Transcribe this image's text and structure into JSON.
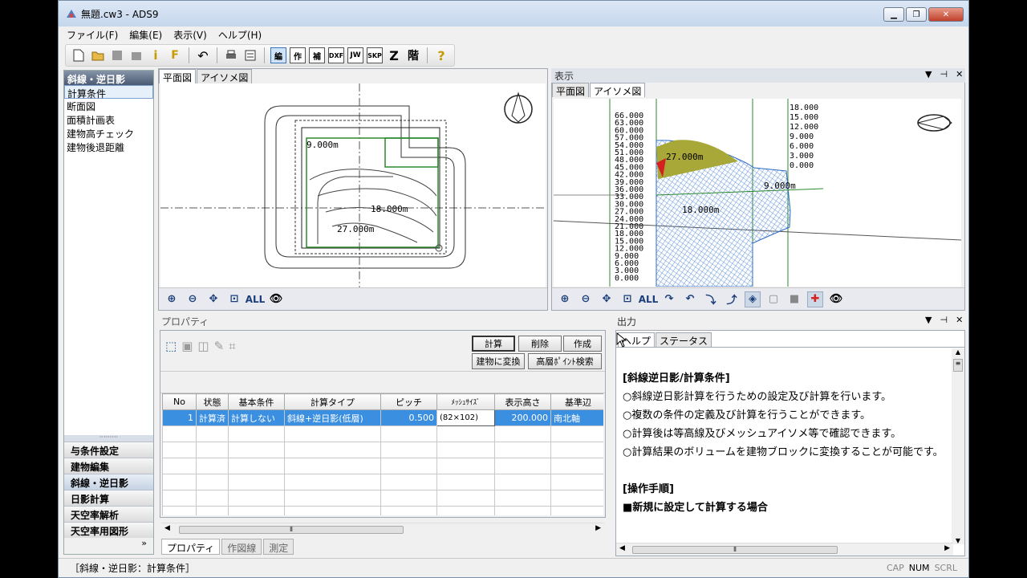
{
  "window": {
    "title": "無題.cw3 - ADS9",
    "min": "▁",
    "max": "❐",
    "close": "✕"
  },
  "menu": [
    "ファイル(F)",
    "編集(E)",
    "表示(V)",
    "ヘルプ(H)"
  ],
  "toolbar": {
    "edit": "編",
    "create": "作",
    "supp": "補",
    "dxf": "DXF",
    "jw": "JW",
    "skp": "SKP",
    "z": "Z",
    "floor": "階",
    "help": "?"
  },
  "sidebar": {
    "header": "斜線・逆日影",
    "items": [
      "計算条件",
      "断面図",
      "面積計画表",
      "建物高チェック",
      "建物後退距離"
    ],
    "nav": [
      "与条件設定",
      "建物編集",
      "斜線・逆日影",
      "日影計算",
      "天空率解析",
      "天空率用図形"
    ],
    "more": "»"
  },
  "plan_panel": {
    "tabs": [
      "平面図",
      "アイソメ図"
    ],
    "labels": [
      "9.000m",
      "18.000m",
      "27.000m"
    ],
    "all": "ALL"
  },
  "view_panel": {
    "title": "表示",
    "tabs": [
      "平面図",
      "アイソメ図"
    ],
    "left_scale": [
      "66.000",
      "63.000",
      "60.000",
      "57.000",
      "54.000",
      "51.000",
      "48.000",
      "45.000",
      "42.000",
      "39.000",
      "36.000",
      "33.000",
      "30.000",
      "27.000",
      "24.000",
      "21.000",
      "18.000",
      "15.000",
      "12.000",
      "9.000",
      "6.000",
      "3.000",
      "0.000"
    ],
    "right_scale": [
      "18.000",
      "15.000",
      "12.000",
      "9.000",
      "6.000",
      "3.000",
      "0.000"
    ],
    "labels": [
      "9.000m",
      "18.000m",
      "27.000m"
    ],
    "all": "ALL"
  },
  "props": {
    "title": "プロパティ",
    "buttons": {
      "calc": "計算",
      "delete": "削除",
      "create": "作成",
      "convert": "建物に変換",
      "search": "高層ﾎﾟｲﾝﾄ検索"
    },
    "columns": [
      "No",
      "状態",
      "基本条件",
      "計算タイプ",
      "ピッチ",
      "ﾒｯｼｭｻｲｽﾞ",
      "表示高さ",
      "基準辺"
    ],
    "rows": [
      [
        "1",
        "計算済",
        "計算しない",
        "斜線+逆日影(低層)",
        "0.500",
        "(82×102)",
        "200.000",
        "南北軸"
      ]
    ],
    "tabs": [
      "プロパティ",
      "作図線",
      "測定"
    ]
  },
  "output": {
    "title": "出力",
    "tabs": [
      "ヘルプ",
      "ステータス"
    ],
    "lines": [
      "[斜線逆日影/計算条件]",
      "○斜線逆日影計算を行うための設定及び計算を行います。",
      "○複数の条件の定義及び計算を行うことができます。",
      "○計算後は等高線及びメッシュアイソメ等で確認できます。",
      "○計算結果のボリュームを建物ブロックに変換することが可能です。",
      "",
      "[操作手順]",
      "■新規に設定して計算する場合"
    ]
  },
  "status": {
    "text": "［斜線・逆日影：計算条件］",
    "cap": "CAP",
    "num": "NUM",
    "scrl": "SCRL"
  }
}
